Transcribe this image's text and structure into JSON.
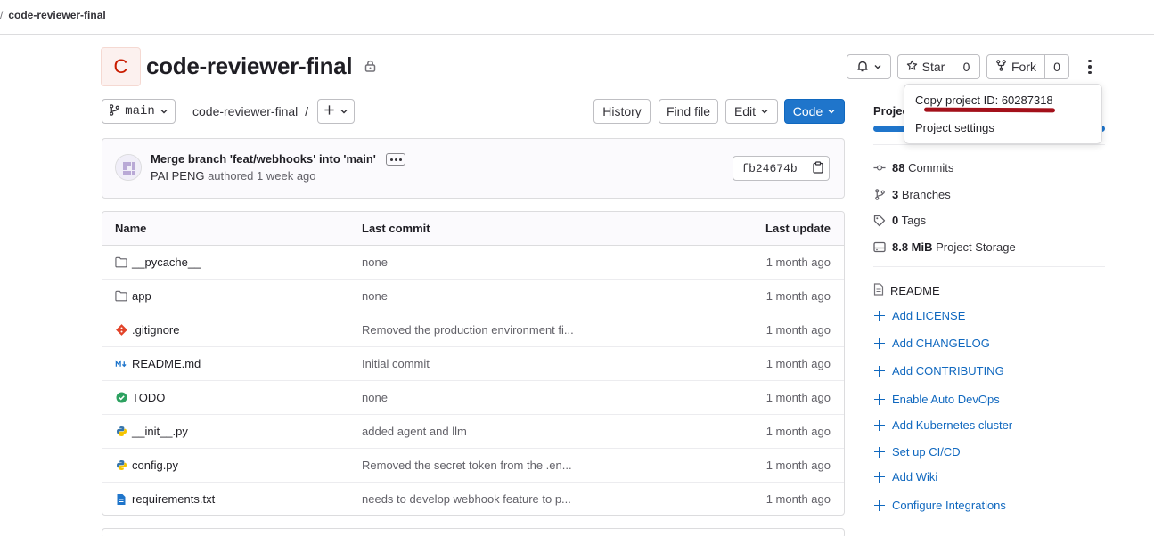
{
  "breadcrumb": {
    "separator": "/",
    "current": "code-reviewer-final"
  },
  "project": {
    "avatar_letter": "C",
    "name": "code-reviewer-final"
  },
  "actions": {
    "star_label": "Star",
    "star_count": "0",
    "fork_label": "Fork",
    "fork_count": "0"
  },
  "toolbar": {
    "branch": "main",
    "path": "code-reviewer-final",
    "path_sep": "/",
    "history": "History",
    "find_file": "Find file",
    "edit": "Edit",
    "code": "Code"
  },
  "commit": {
    "message": "Merge branch 'feat/webhooks' into 'main'",
    "author": "PAI PENG",
    "meta": "authored 1 week ago",
    "sha": "fb24674b"
  },
  "table": {
    "headers": {
      "name": "Name",
      "last_commit": "Last commit",
      "last_update": "Last update"
    },
    "rows": [
      {
        "name": "__pycache__",
        "icon": "folder-icon",
        "commit": "none",
        "date": "1 month ago"
      },
      {
        "name": "app",
        "icon": "folder-icon",
        "commit": "none",
        "date": "1 month ago"
      },
      {
        "name": ".gitignore",
        "icon": "git-icon",
        "commit": "Removed the production environment fi...",
        "date": "1 month ago"
      },
      {
        "name": "README.md",
        "icon": "markdown-icon",
        "commit": "Initial commit",
        "date": "1 month ago"
      },
      {
        "name": "TODO",
        "icon": "check-circle-icon",
        "commit": "none",
        "date": "1 month ago"
      },
      {
        "name": "__init__.py",
        "icon": "python-icon",
        "commit": "added agent and llm",
        "date": "1 month ago"
      },
      {
        "name": "config.py",
        "icon": "python-icon",
        "commit": "Removed the secret token from the .en...",
        "date": "1 month ago"
      },
      {
        "name": "requirements.txt",
        "icon": "text-file-icon",
        "commit": "needs to develop webhook feature to p...",
        "date": "1 month ago"
      }
    ]
  },
  "sidebar": {
    "heading": "Projec",
    "stats": [
      {
        "count": "88",
        "label": "Commits",
        "icon": "commit-icon"
      },
      {
        "count": "3",
        "label": "Branches",
        "icon": "branch-icon"
      },
      {
        "count": "0",
        "label": "Tags",
        "icon": "tag-icon"
      },
      {
        "count": "8.8 MiB",
        "label": "Project Storage",
        "icon": "storage-icon"
      }
    ],
    "readme": "README",
    "links": [
      "Add LICENSE",
      "Add CHANGELOG",
      "Add CONTRIBUTING",
      "Enable Auto DevOps",
      "Add Kubernetes cluster",
      "Set up CI/CD",
      "Add Wiki",
      "Configure Integrations"
    ]
  },
  "dropdown": {
    "copy_id": "Copy project ID: 60287318",
    "settings": "Project settings"
  },
  "colors": {
    "primary": "#1f75cb",
    "link": "#1068bf",
    "annotation": "#a3101a"
  }
}
